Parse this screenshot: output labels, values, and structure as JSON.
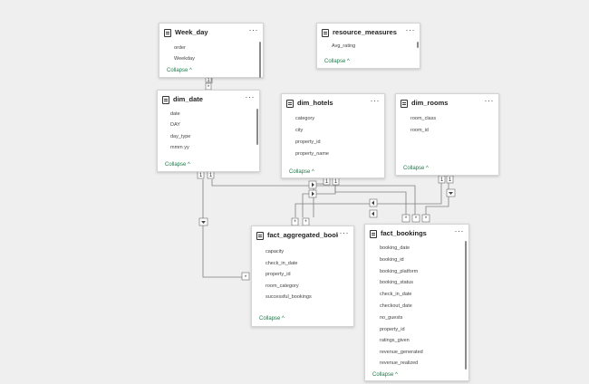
{
  "ui": {
    "menu_glyph": "···",
    "collapse_label": "Collapse ^"
  },
  "colors": {
    "canvas": "#efefef",
    "link_line": "#808080",
    "collapse_text": "#1e7a4a"
  },
  "cards": {
    "week_day": {
      "title": "Week_day",
      "fields": [
        "order",
        "Weekday"
      ]
    },
    "resource_measures": {
      "title": "resource_measures",
      "fields": [
        "Avg_rating"
      ]
    },
    "dim_date": {
      "title": "dim_date",
      "fields": [
        "date",
        "DAY",
        "day_type",
        "mmm yy"
      ]
    },
    "dim_hotels": {
      "title": "dim_hotels",
      "fields": [
        "category",
        "city",
        "property_id",
        "property_name"
      ]
    },
    "dim_rooms": {
      "title": "dim_rooms",
      "fields": [
        "room_class",
        "room_id"
      ]
    },
    "fact_aggregated": {
      "title": "fact_aggregated_booki...",
      "fields": [
        "capacity",
        "check_in_date",
        "property_id",
        "room_category",
        "successful_bookings"
      ]
    },
    "fact_bookings": {
      "title": "fact_bookings",
      "fields": [
        "booking_date",
        "booking_id",
        "booking_platform",
        "booking_status",
        "check_in_date",
        "checkout_date",
        "no_guests",
        "property_id",
        "ratings_given",
        "revenue_generated",
        "revenue_realized"
      ]
    }
  },
  "relationships": [
    {
      "from": "Week_day",
      "to": "dim_date",
      "one": "1",
      "many": "*"
    },
    {
      "from": "dim_date",
      "to": "fact_aggregated_bookings",
      "one": "1",
      "many": "*"
    },
    {
      "from": "dim_date",
      "to": "fact_bookings",
      "one": "1",
      "many": "*"
    },
    {
      "from": "dim_hotels",
      "to": "fact_aggregated_bookings",
      "one": "1",
      "many": "*"
    },
    {
      "from": "dim_hotels",
      "to": "fact_bookings",
      "one": "1",
      "many": "*"
    },
    {
      "from": "dim_rooms",
      "to": "fact_aggregated_bookings",
      "one": "1",
      "many": "*"
    },
    {
      "from": "dim_rooms",
      "to": "fact_bookings",
      "one": "1",
      "many": "*"
    }
  ]
}
